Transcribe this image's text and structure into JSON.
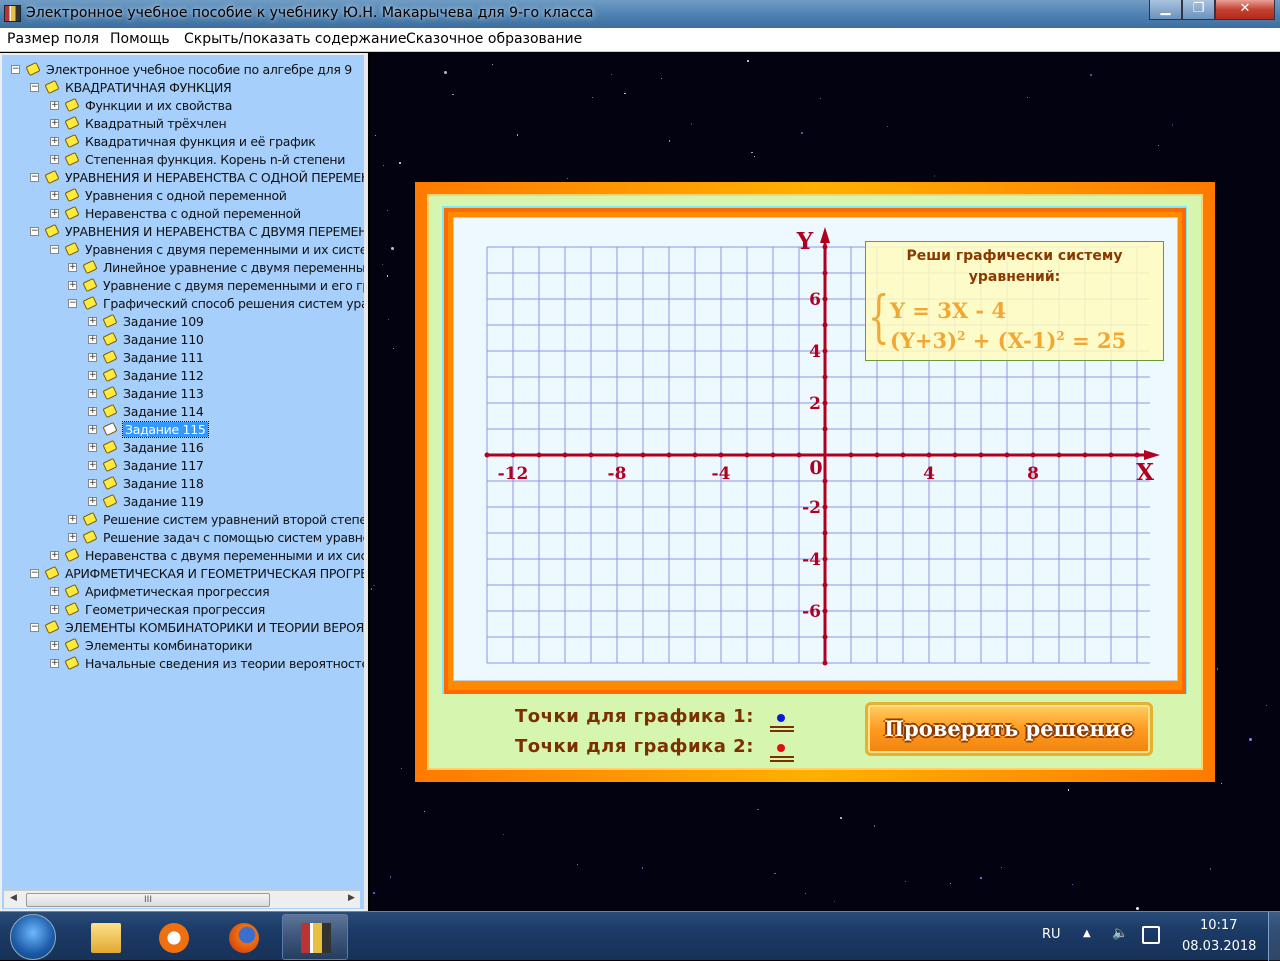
{
  "window": {
    "title": "Электронное учебное пособие к учебнику Ю.Н. Макарычева для 9-го класса",
    "minimize": "▁",
    "maximize": "❐",
    "close": "✕"
  },
  "menu": [
    "Размер поля",
    "Помощь",
    "Скрыть/показать содержание",
    "Сказочное образование"
  ],
  "tree": [
    {
      "level": 0,
      "exp": "−",
      "label": "Электронное учебное пособие по алгебре для 9"
    },
    {
      "level": 1,
      "exp": "−",
      "label": "КВАДРАТИЧНАЯ ФУНКЦИЯ"
    },
    {
      "level": 2,
      "exp": "+",
      "label": "Функции и их свойства"
    },
    {
      "level": 2,
      "exp": "+",
      "label": "Квадратный трёхчлен"
    },
    {
      "level": 2,
      "exp": "+",
      "label": "Квадратичная функция и её график"
    },
    {
      "level": 2,
      "exp": "+",
      "label": "Степенная функция. Корень n-й степени"
    },
    {
      "level": 1,
      "exp": "−",
      "label": "УРАВНЕНИЯ И НЕРАВЕНСТВА С ОДНОЙ ПЕРЕМЕННОЙ"
    },
    {
      "level": 2,
      "exp": "+",
      "label": "Уравнения с одной переменной"
    },
    {
      "level": 2,
      "exp": "+",
      "label": "Неравенства с одной переменной"
    },
    {
      "level": 1,
      "exp": "−",
      "label": "УРАВНЕНИЯ И НЕРАВЕНСТВА С ДВУМЯ ПЕРЕМЕННЫМИ"
    },
    {
      "level": 2,
      "exp": "−",
      "label": "Уравнения с двумя переменными и их системы"
    },
    {
      "level": 3,
      "exp": "+",
      "label": "Линейное уравнение с двумя переменными"
    },
    {
      "level": 3,
      "exp": "+",
      "label": "Уравнение с двумя переменными и его график"
    },
    {
      "level": 3,
      "exp": "−",
      "label": "Графический способ решения систем уравнений"
    },
    {
      "level": 4,
      "exp": "+",
      "label": "Задание 109"
    },
    {
      "level": 4,
      "exp": "+",
      "label": "Задание 110"
    },
    {
      "level": 4,
      "exp": "+",
      "label": "Задание 111"
    },
    {
      "level": 4,
      "exp": "+",
      "label": "Задание 112"
    },
    {
      "level": 4,
      "exp": "+",
      "label": "Задание 113"
    },
    {
      "level": 4,
      "exp": "+",
      "label": "Задание 114"
    },
    {
      "level": 4,
      "exp": "+",
      "label": "Задание 115",
      "selected": true
    },
    {
      "level": 4,
      "exp": "+",
      "label": "Задание 116"
    },
    {
      "level": 4,
      "exp": "+",
      "label": "Задание 117"
    },
    {
      "level": 4,
      "exp": "+",
      "label": "Задание 118"
    },
    {
      "level": 4,
      "exp": "+",
      "label": "Задание 119"
    },
    {
      "level": 3,
      "exp": "+",
      "label": "Решение систем уравнений второй степени"
    },
    {
      "level": 3,
      "exp": "+",
      "label": "Решение задач с помощью систем уравнений"
    },
    {
      "level": 2,
      "exp": "+",
      "label": "Неравенства с двумя переменными и их системы"
    },
    {
      "level": 1,
      "exp": "−",
      "label": "АРИФМЕТИЧЕСКАЯ И ГЕОМЕТРИЧЕСКАЯ ПРОГРЕССИИ"
    },
    {
      "level": 2,
      "exp": "+",
      "label": "Арифметическая прогрессия"
    },
    {
      "level": 2,
      "exp": "+",
      "label": "Геометрическая прогрессия"
    },
    {
      "level": 1,
      "exp": "−",
      "label": "ЭЛЕМЕНТЫ КОМБИНАТОРИКИ И ТЕОРИИ ВЕРОЯТНОСТЕЙ"
    },
    {
      "level": 2,
      "exp": "+",
      "label": "Элементы комбинаторики"
    },
    {
      "level": 2,
      "exp": "+",
      "label": "Начальные сведения из теории вероятностей"
    }
  ],
  "scrollbar": {
    "thumb": "III",
    "left": "◀",
    "right": "▶"
  },
  "graph": {
    "x_label": "X",
    "y_label": "Y",
    "origin": "0",
    "x_ticks": [
      -12,
      -8,
      -4,
      4,
      8
    ],
    "y_ticks": [
      6,
      4,
      2,
      -2,
      -4,
      -6
    ],
    "axis_color": "#b00020"
  },
  "task": {
    "title_line1": "Реши графически систему",
    "title_line2": "уравнений:",
    "eq1": "Y = 3X - 4",
    "eq2_a": "(Y+3)",
    "eq2_b": "+ (X-1)",
    "eq2_c": "= 25",
    "exp": "2",
    "brace": "{"
  },
  "points": [
    {
      "label": "Точки для графика 1:",
      "color": "#0a1ad8"
    },
    {
      "label": "Точки для графика 2:",
      "color": "#e01010"
    }
  ],
  "check_button": "Проверить решение",
  "taskbar": {
    "lang": "RU",
    "tray_arrow": "▲",
    "volume": "🔈",
    "time": "10:17",
    "date": "08.03.2018"
  }
}
